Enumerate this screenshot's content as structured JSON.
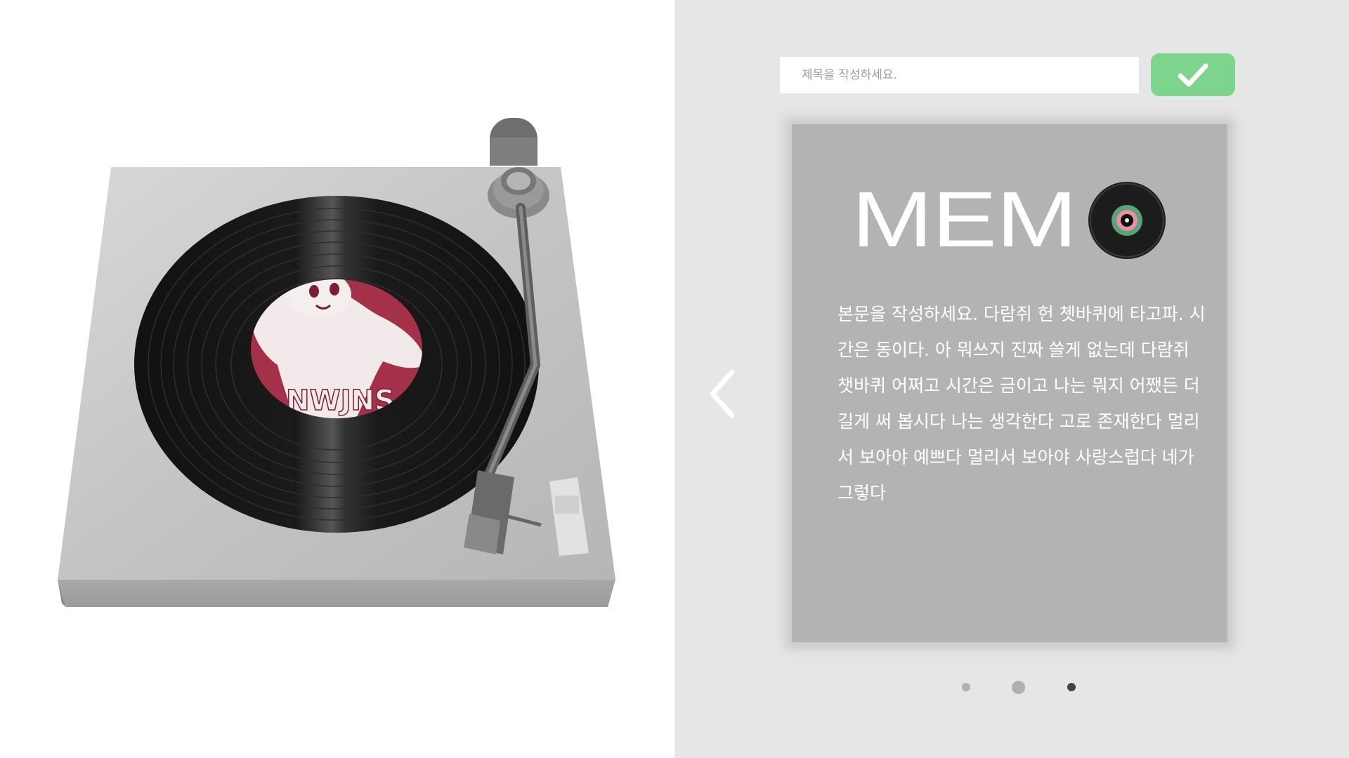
{
  "turntable": {
    "record_label_text": "NWJNS"
  },
  "editor": {
    "title_placeholder": "제목을 작성하세요.",
    "title_value": "",
    "confirm_icon": "check-icon",
    "prev_icon": "chevron-left-icon",
    "confirm_color": "#7dd58d"
  },
  "memo": {
    "logo_text": "MEMO",
    "body": "본문을 작성하세요. 다람쥐 헌 쳇바퀴에 타고파. 시간은 동이다. 아 뭐쓰지 진짜 쓸게 없는데 다람쥐 챗바퀴 어쩌고 시간은 금이고 나는 뭐지 어쨌든 더 길게 써 봅시다 나는 생각한다 고로 존재한다 멀리서 보아야 예쁘다 멀리서 보아야 사랑스럽다 네가 그렇다",
    "card_color": "#b3b3b3"
  },
  "pagination": {
    "pages": 3,
    "active_index": 3
  }
}
